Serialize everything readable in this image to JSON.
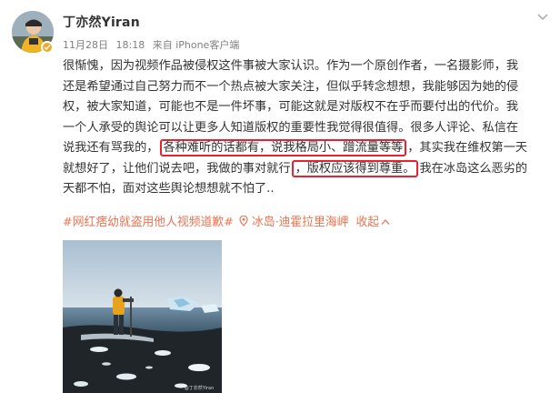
{
  "author": {
    "name": "丁亦然Yiran"
  },
  "meta": {
    "date": "11月28日",
    "time": "18:18",
    "source": "来自 iPhone客户端"
  },
  "post": {
    "lines": [
      {
        "parts": [
          "很惭愧，因为视频作品被侵权这件事被大家认识。作为一个原创作者，一名摄影师，我"
        ]
      },
      {
        "parts": [
          "还是希望通过自己努力而不一个热点被大家关注，但似乎转念想想，我能够因为她的侵"
        ]
      },
      {
        "parts": [
          "权，被大家知道，可能也不是一件坏事，可能这就是对版权不在乎而要付出的代价。我"
        ]
      },
      {
        "parts": [
          "一个人承受的舆论可以让更多人知道版权的重要性我觉得很值得。很多人评论、私信在"
        ]
      },
      {
        "parts": [
          "说我还有骂我的，",
          "各种难听的话都有，说我格局小、蹭流量等等",
          "，其实我在维权第一天"
        ]
      },
      {
        "parts": [
          "就想好了，让他们说去吧，我做的事对就行",
          "，版权应该得到尊重。",
          "我在冰岛这么恶劣的"
        ]
      },
      {
        "parts": [
          "天都不怕，面对这些舆论想想就不怕了.."
        ]
      }
    ]
  },
  "tags": {
    "topic": "#网红痞幼就盗用他人视频道歉#",
    "location": "冰岛·迪霍拉里海岬",
    "collapse": "收起"
  },
  "photo": {
    "watermark": "@丁亦然Yiran"
  },
  "colors": {
    "highlight_border": "#e8222f",
    "link": "#eb7350",
    "badge": "#f5a623"
  },
  "icons": {
    "verified": "verified-badge-icon",
    "location": "location-pin-icon",
    "collapse": "collapse-up-icon",
    "more": "chevron-down-icon"
  }
}
